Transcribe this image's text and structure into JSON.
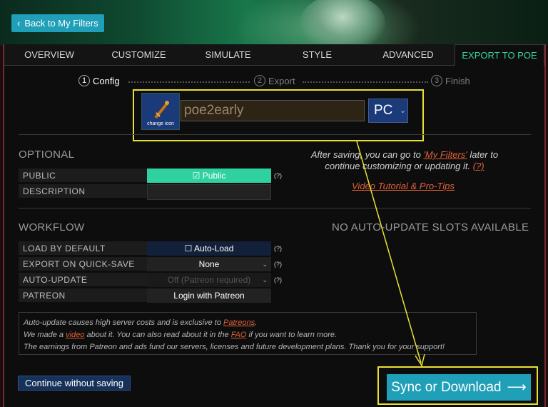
{
  "header": {
    "back_label": "Back to My Filters"
  },
  "tabs": [
    {
      "label": "OVERVIEW"
    },
    {
      "label": "CUSTOMIZE"
    },
    {
      "label": "SIMULATE"
    },
    {
      "label": "STYLE"
    },
    {
      "label": "ADVANCED"
    },
    {
      "label": "EXPORT TO POE",
      "active": true
    }
  ],
  "steps": [
    {
      "num": "1",
      "label": "Config"
    },
    {
      "num": "2",
      "label": "Export"
    },
    {
      "num": "3",
      "label": "Finish"
    }
  ],
  "config": {
    "icon_label": "change icon",
    "filter_name": "poe2early",
    "platform": "PC"
  },
  "optional": {
    "title": "OPTIONAL",
    "public_label": "PUBLIC",
    "public_value": "☑ Public",
    "description_label": "DESCRIPTION",
    "help": "(?)"
  },
  "side": {
    "text_1": "After saving, you can go to ",
    "link_my_filters": "'My Filters'",
    "text_2": " later to continue customizing or updating it. ",
    "help_link": "(?)",
    "video_link": "Video Tutorial & Pro-Tips"
  },
  "workflow": {
    "title": "WORKFLOW",
    "no_slots": "NO AUTO-UPDATE SLOTS AVAILABLE",
    "load_label": "LOAD BY DEFAULT",
    "load_value": "☐ Auto-Load",
    "export_label": "EXPORT ON QUICK-SAVE",
    "export_value": "None",
    "autoupdate_label": "AUTO-UPDATE",
    "autoupdate_value": "Off (Patreon required)",
    "patreon_label": "PATREON",
    "patreon_value": "Login with Patreon"
  },
  "note": {
    "line1_a": "Auto-update causes high server costs and is exclusive to ",
    "line1_link": "Patreons",
    "line1_b": ".",
    "line2_a": "We made a ",
    "line2_link1": "video",
    "line2_b": " about it. You can also read about it in the ",
    "line2_link2": "FAQ",
    "line2_c": " if you want to learn more.",
    "line3": "The earnings from Patreon and ads fund our servers, licenses and future development plans. Thank you for your support!"
  },
  "footer": {
    "continue_label": "Continue without saving",
    "sync_label": "Sync or Download",
    "sync_arrow": "⟶"
  },
  "colors": {
    "accent": "#1f9fb8",
    "active_tab": "#34d3a0",
    "highlight": "#e8e135",
    "link": "#e0603a"
  }
}
